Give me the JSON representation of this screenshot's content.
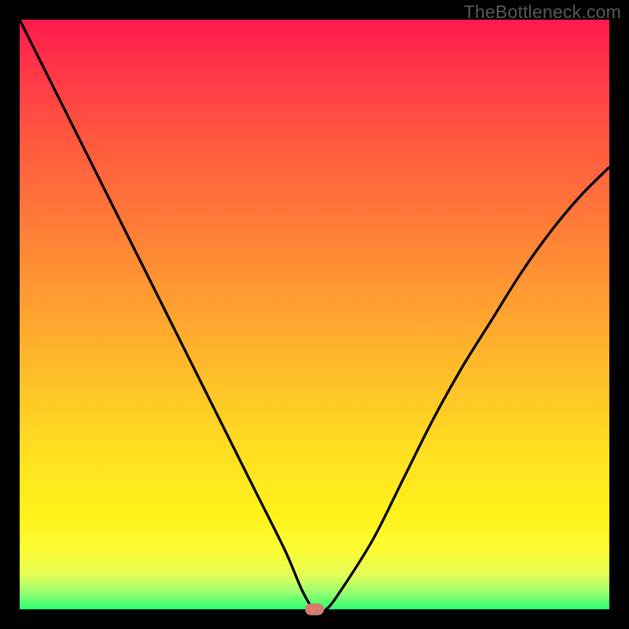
{
  "watermark": "TheBottleneck.com",
  "colors": {
    "frame": "#000000",
    "top": "#ff1a4d",
    "mid": "#ffe020",
    "bottom": "#2dff74",
    "curve": "#000000",
    "marker": "#d8796e"
  },
  "chart_data": {
    "type": "line",
    "title": "",
    "xlabel": "",
    "ylabel": "",
    "xlim": [
      0,
      100
    ],
    "ylim": [
      0,
      100
    ],
    "grid": false,
    "legend": false,
    "series": [
      {
        "name": "bottleneck-curve",
        "x": [
          0,
          5,
          10,
          15,
          20,
          25,
          30,
          35,
          40,
          45,
          48,
          50,
          52,
          55,
          60,
          65,
          70,
          75,
          80,
          85,
          90,
          95,
          100
        ],
        "values": [
          100,
          90,
          80,
          70,
          60,
          50,
          40,
          30,
          20,
          10,
          3,
          0,
          0,
          4,
          12,
          22,
          32,
          41,
          49,
          57,
          64,
          70,
          75
        ]
      }
    ],
    "annotations": [
      {
        "name": "optimal-marker",
        "x": 50,
        "y": 0
      }
    ]
  }
}
